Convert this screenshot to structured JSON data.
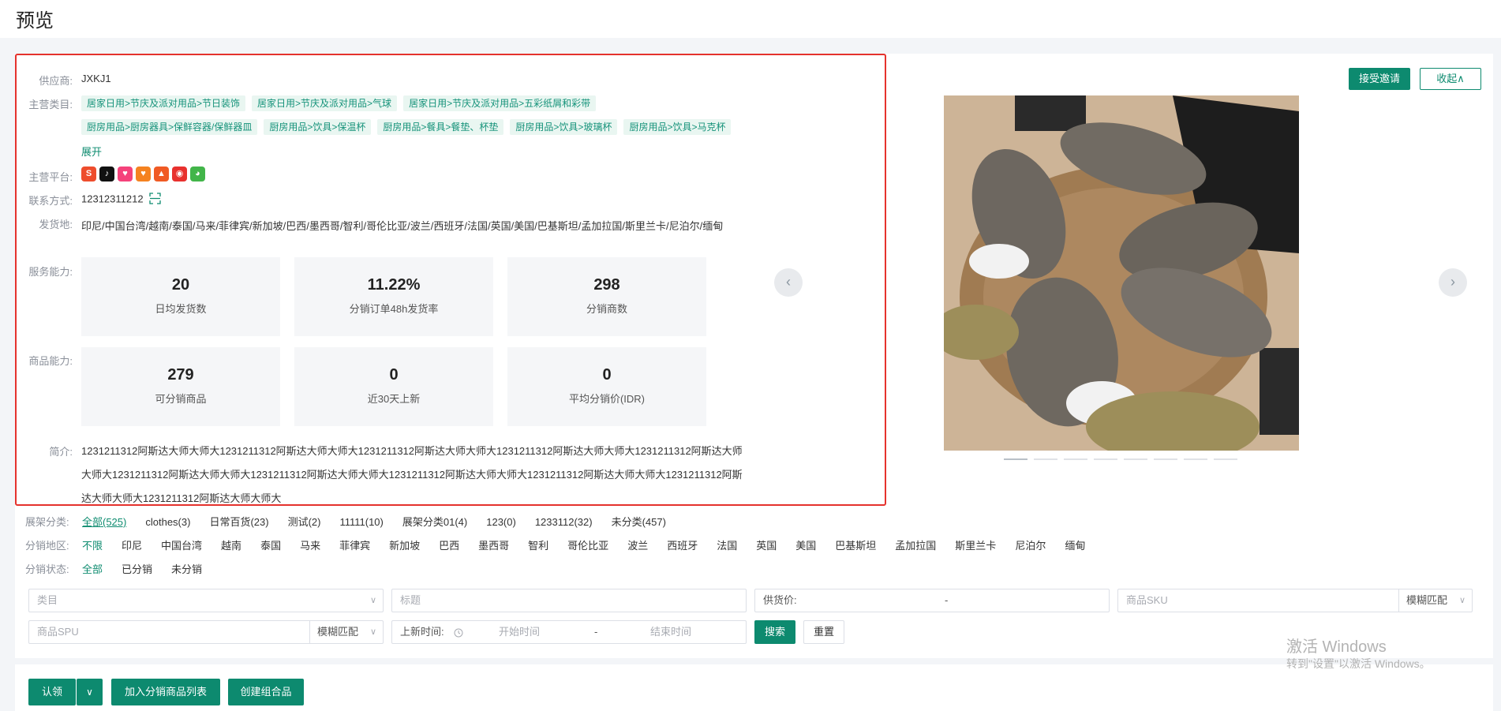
{
  "page": {
    "title": "预览"
  },
  "supplier": {
    "label": "供应商:",
    "value": "JXKJ1"
  },
  "category": {
    "label": "主营类目:",
    "tags": [
      "居家日用>节庆及派对用品>节日装饰",
      "居家日用>节庆及派对用品>气球",
      "居家日用>节庆及派对用品>五彩纸屑和彩带",
      "厨房用品>厨房器具>保鲜容器/保鲜器皿",
      "厨房用品>饮具>保温杯",
      "厨房用品>餐具>餐垫、杯垫",
      "厨房用品>饮具>玻璃杯",
      "厨房用品>饮具>马克杯"
    ],
    "expand": "展开"
  },
  "platforms": {
    "label": "主营平台:",
    "icons": [
      {
        "name": "shopee-icon",
        "glyph": "S",
        "color": "#ee4d2d"
      },
      {
        "name": "tiktok-icon",
        "glyph": "♪",
        "color": "#111111"
      },
      {
        "name": "lazada-icon",
        "glyph": "♥",
        "color": "#f5427b"
      },
      {
        "name": "lazada-alt-icon",
        "glyph": "♥",
        "color": "#f58220"
      },
      {
        "name": "tokopedia-flame-icon",
        "glyph": "▲",
        "color": "#f05a24"
      },
      {
        "name": "shop-red-icon",
        "glyph": "◉",
        "color": "#e8312e"
      },
      {
        "name": "tokopedia-icon",
        "glyph": "◕",
        "color": "#42b549"
      }
    ]
  },
  "contact": {
    "label": "联系方式:",
    "value": "12312311212"
  },
  "ship_from": {
    "label": "发货地:",
    "value": "印尼/中国台湾/越南/泰国/马来/菲律宾/新加坡/巴西/墨西哥/智利/哥伦比亚/波兰/西班牙/法国/英国/美国/巴基斯坦/孟加拉国/斯里兰卡/尼泊尔/缅甸"
  },
  "service": {
    "label": "服务能力:",
    "stats": [
      {
        "num": "20",
        "cap": "日均发货数"
      },
      {
        "num": "11.22%",
        "cap": "分销订单48h发货率"
      },
      {
        "num": "298",
        "cap": "分销商数"
      }
    ]
  },
  "product": {
    "label": "商品能力:",
    "stats": [
      {
        "num": "279",
        "cap": "可分销商品"
      },
      {
        "num": "0",
        "cap": "近30天上新"
      },
      {
        "num": "0",
        "cap": "平均分销价(IDR)"
      }
    ]
  },
  "intro": {
    "label": "简介:",
    "value": "1231211312阿斯达大师大师大1231211312阿斯达大师大师大1231211312阿斯达大师大师大1231211312阿斯达大师大师大1231211312阿斯达大师大师大1231211312阿斯达大师大师大1231211312阿斯达大师大师大1231211312阿斯达大师大师大1231211312阿斯达大师大师大1231211312阿斯达大师大师大1231211312阿斯达大师大师大"
  },
  "actions": {
    "accept": "接受邀请",
    "collapse": "收起∧"
  },
  "carousel": {
    "prev": "‹",
    "next": "›",
    "slides": 8,
    "active": 0
  },
  "filters": {
    "shelf": {
      "label": "展架分类:",
      "options": [
        "全部(525)",
        "clothes(3)",
        "日常百货(23)",
        "测试(2)",
        "11111(10)",
        "展架分类01(4)",
        "123(0)",
        "1233112(32)",
        "未分类(457)"
      ]
    },
    "region": {
      "label": "分销地区:",
      "options": [
        "不限",
        "印尼",
        "中国台湾",
        "越南",
        "泰国",
        "马来",
        "菲律宾",
        "新加坡",
        "巴西",
        "墨西哥",
        "智利",
        "哥伦比亚",
        "波兰",
        "西班牙",
        "法国",
        "英国",
        "美国",
        "巴基斯坦",
        "孟加拉国",
        "斯里兰卡",
        "尼泊尔",
        "缅甸"
      ]
    },
    "status": {
      "label": "分销状态:",
      "options": [
        "全部",
        "已分销",
        "未分销"
      ]
    }
  },
  "search": {
    "category_placeholder": "类目",
    "title_placeholder": "标题",
    "price_label": "供货价:",
    "price_dash": "-",
    "sku_placeholder": "商品SKU",
    "sku_match": "模糊匹配",
    "spu_placeholder": "商品SPU",
    "spu_match": "模糊匹配",
    "time_label": "上新时间:",
    "start_placeholder": "开始时间",
    "time_dash": "-",
    "end_placeholder": "结束时间",
    "search_btn": "搜索",
    "reset_btn": "重置"
  },
  "bottom": {
    "claim": "认领",
    "add_list": "加入分销商品列表",
    "create_combo": "创建组合品"
  },
  "watermark": {
    "line1": "激活 Windows",
    "line2": "转到\"设置\"以激活 Windows。"
  }
}
